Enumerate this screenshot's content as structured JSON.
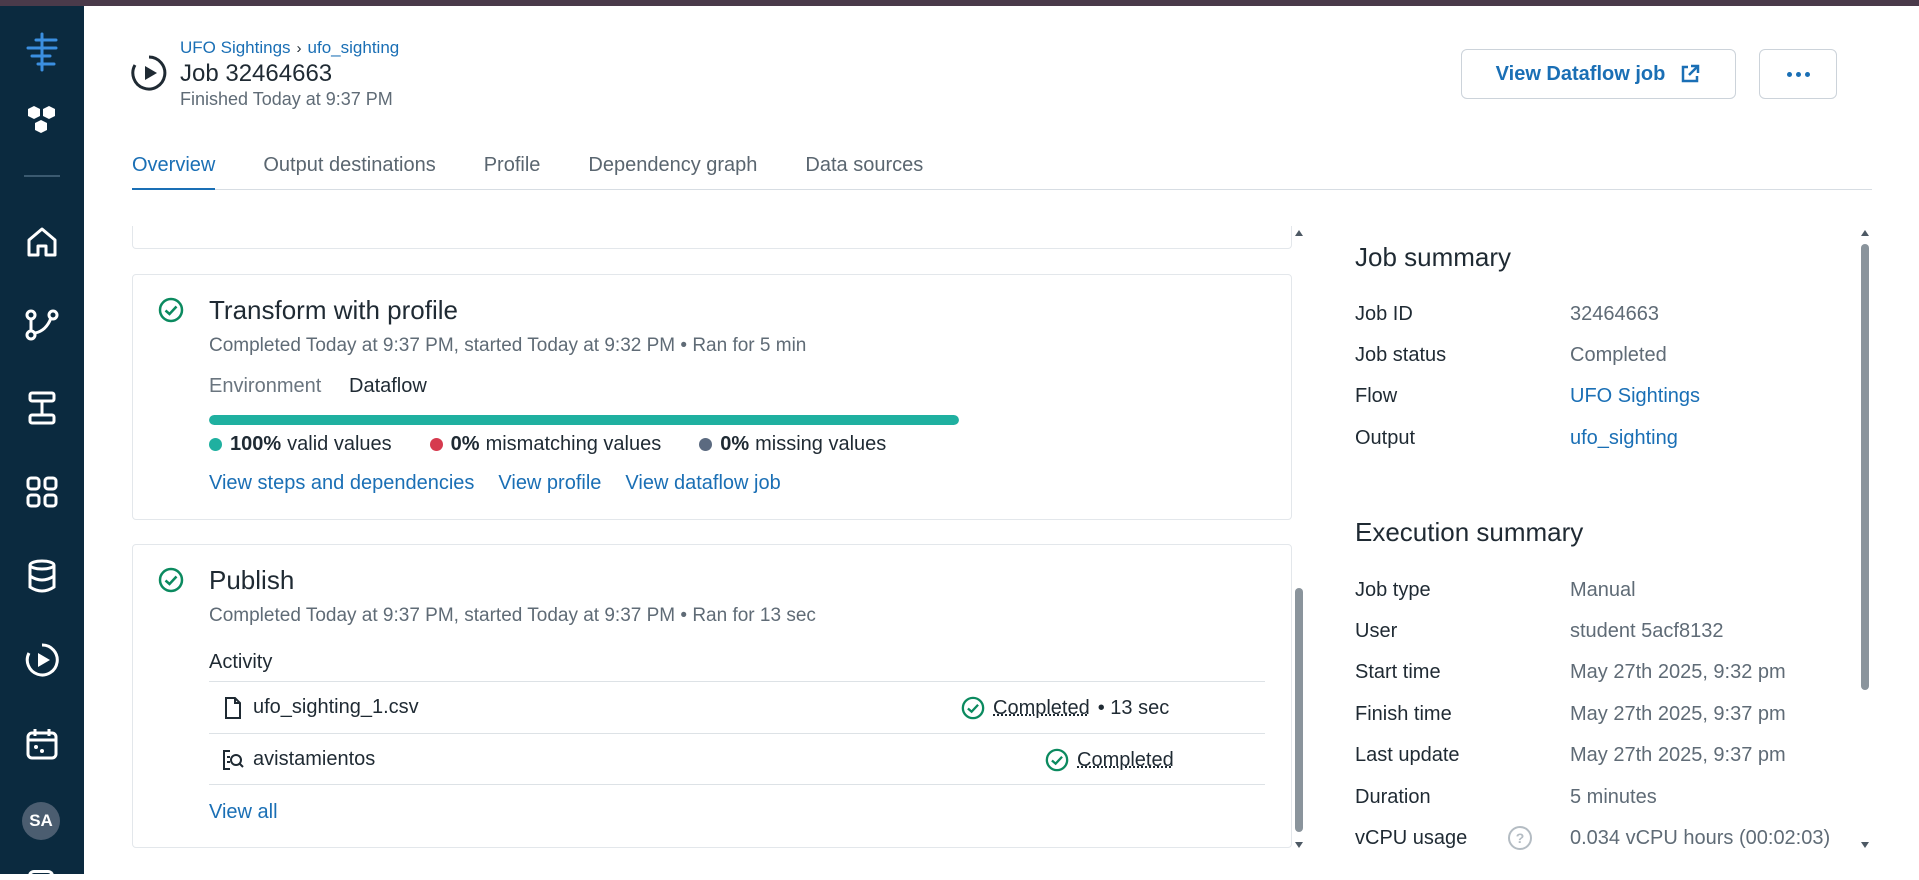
{
  "breadcrumb": {
    "flow": "UFO Sightings",
    "separator": "›",
    "output": "ufo_sighting"
  },
  "job": {
    "title": "Job 32464663",
    "subtitle": "Finished Today at 9:37 PM"
  },
  "header_buttons": {
    "view_dataflow": "View Dataflow job"
  },
  "tabs": [
    "Overview",
    "Output destinations",
    "Profile",
    "Dependency graph",
    "Data sources"
  ],
  "transform": {
    "title": "Transform with profile",
    "meta": "Completed Today at 9:37 PM, started Today at 9:32 PM • Ran for 5 min",
    "environment_label": "Environment",
    "environment_value": "Dataflow",
    "valid_fraction": 1.0,
    "legend": [
      {
        "pct": "100%",
        "label": "valid values",
        "color": "#1fb0a0"
      },
      {
        "pct": "0%",
        "label": "mismatching values",
        "color": "#d63a4e"
      },
      {
        "pct": "0%",
        "label": "missing values",
        "color": "#5b6a80"
      }
    ],
    "links": [
      "View steps and dependencies",
      "View profile",
      "View dataflow job"
    ]
  },
  "publish": {
    "title": "Publish",
    "meta": "Completed Today at 9:37 PM, started Today at 9:37 PM • Ran for 13 sec",
    "activity_label": "Activity",
    "rows": [
      {
        "name": "ufo_sighting_1.csv",
        "status": "Completed",
        "duration": "• 13 sec"
      },
      {
        "name": "avistamientos",
        "status": "Completed",
        "duration": ""
      }
    ],
    "view_all": "View all"
  },
  "job_summary": {
    "title": "Job summary",
    "items": [
      {
        "key": "Job ID",
        "value": "32464663"
      },
      {
        "key": "Job status",
        "value": "Completed"
      },
      {
        "key": "Flow",
        "value": "UFO Sightings"
      },
      {
        "key": "Output",
        "value": "ufo_sighting"
      }
    ]
  },
  "execution_summary": {
    "title": "Execution summary",
    "items": [
      {
        "key": "Job type",
        "value": "Manual"
      },
      {
        "key": "User",
        "value": "student 5acf8132"
      },
      {
        "key": "Start time",
        "value": "May 27th 2025, 9:32 pm"
      },
      {
        "key": "Finish time",
        "value": "May 27th 2025, 9:37 pm"
      },
      {
        "key": "Last update",
        "value": "May 27th 2025, 9:37 pm"
      },
      {
        "key": "Duration",
        "value": "5 minutes"
      },
      {
        "key": "vCPU usage",
        "value": "0.034 vCPU hours (00:02:03)"
      }
    ]
  },
  "user_avatar": "SA",
  "colors": {
    "accent": "#1a6fb5",
    "success": "#0b8a5f",
    "sidebar": "#0b2a3f"
  }
}
